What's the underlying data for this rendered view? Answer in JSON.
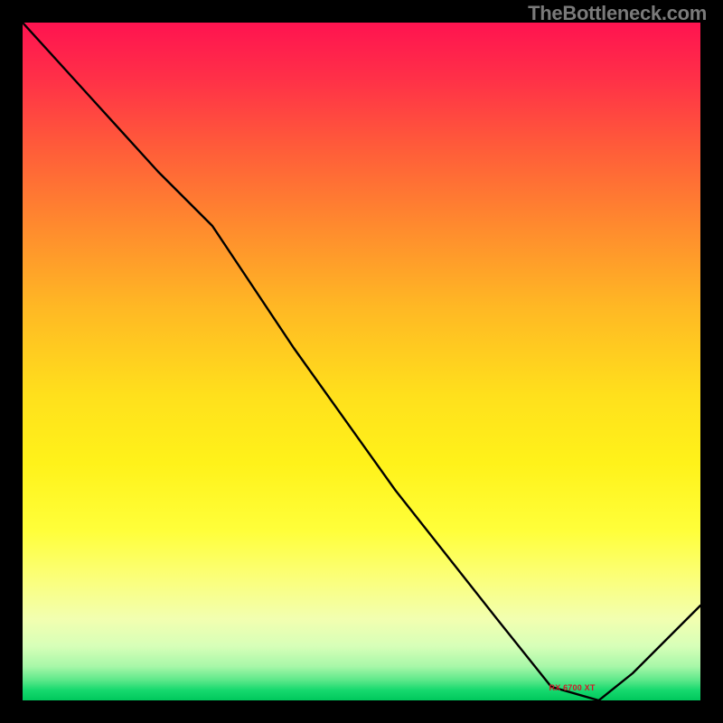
{
  "watermark": "TheBottleneck.com",
  "brand_colors": {
    "curve": "#000000",
    "bg": "#000000",
    "text_muted": "#7a7a7a",
    "marker_text": "#d11a2a"
  },
  "chart_data": {
    "type": "line",
    "title": "",
    "xlabel": "",
    "ylabel": "",
    "xlim": [
      0,
      100
    ],
    "ylim": [
      0,
      100
    ],
    "grid": false,
    "legend": false,
    "series": [
      {
        "name": "bottleneck-curve",
        "x": [
          0,
          10,
          20,
          28,
          40,
          55,
          70,
          78,
          85,
          90,
          100
        ],
        "y": [
          100,
          89,
          78,
          70,
          52,
          31,
          12,
          2,
          0,
          4,
          14
        ]
      }
    ],
    "annotations": [
      {
        "name": "optimal-marker",
        "text": "RX 6700 XT",
        "x": 83,
        "y": 1
      }
    ],
    "gradient_stops": [
      {
        "pct": 0,
        "color": "#ff1350"
      },
      {
        "pct": 30,
        "color": "#ff8a2e"
      },
      {
        "pct": 55,
        "color": "#ffe01c"
      },
      {
        "pct": 82,
        "color": "#fbff7a"
      },
      {
        "pct": 95,
        "color": "#a7f7a8"
      },
      {
        "pct": 100,
        "color": "#00c85c"
      }
    ]
  }
}
